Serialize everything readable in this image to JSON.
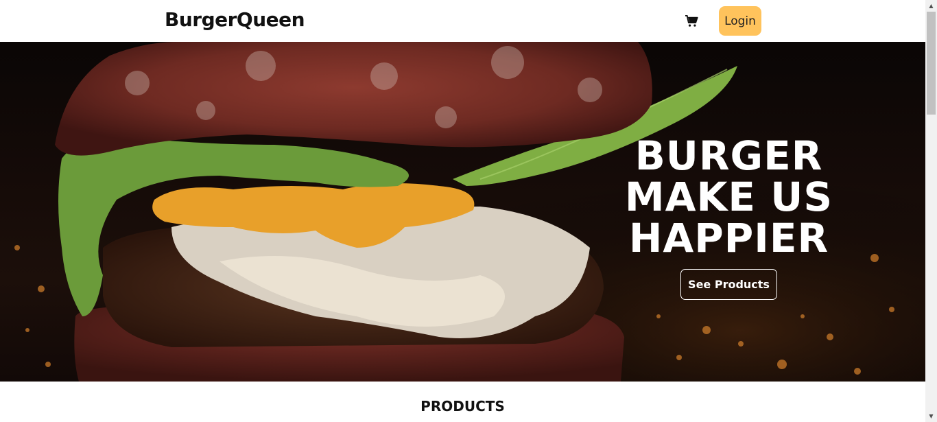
{
  "header": {
    "brand": "BurgerQueen",
    "cart_icon": "cart-icon",
    "login_label": "Login"
  },
  "hero": {
    "headline_lines": [
      "BURGER",
      "MAKE US",
      "HAPPIER"
    ],
    "cta_label": "See Products"
  },
  "products": {
    "title": "PRODUCTS"
  },
  "colors": {
    "login_bg": "#ffc35c",
    "hero_text": "#ffffff",
    "bun": "#7a2f26",
    "cheese": "#e8a02a",
    "lettuce": "#6b9b3a"
  },
  "scrollbar": {
    "up_icon": "arrow-up-icon",
    "down_icon": "arrow-down-icon"
  }
}
